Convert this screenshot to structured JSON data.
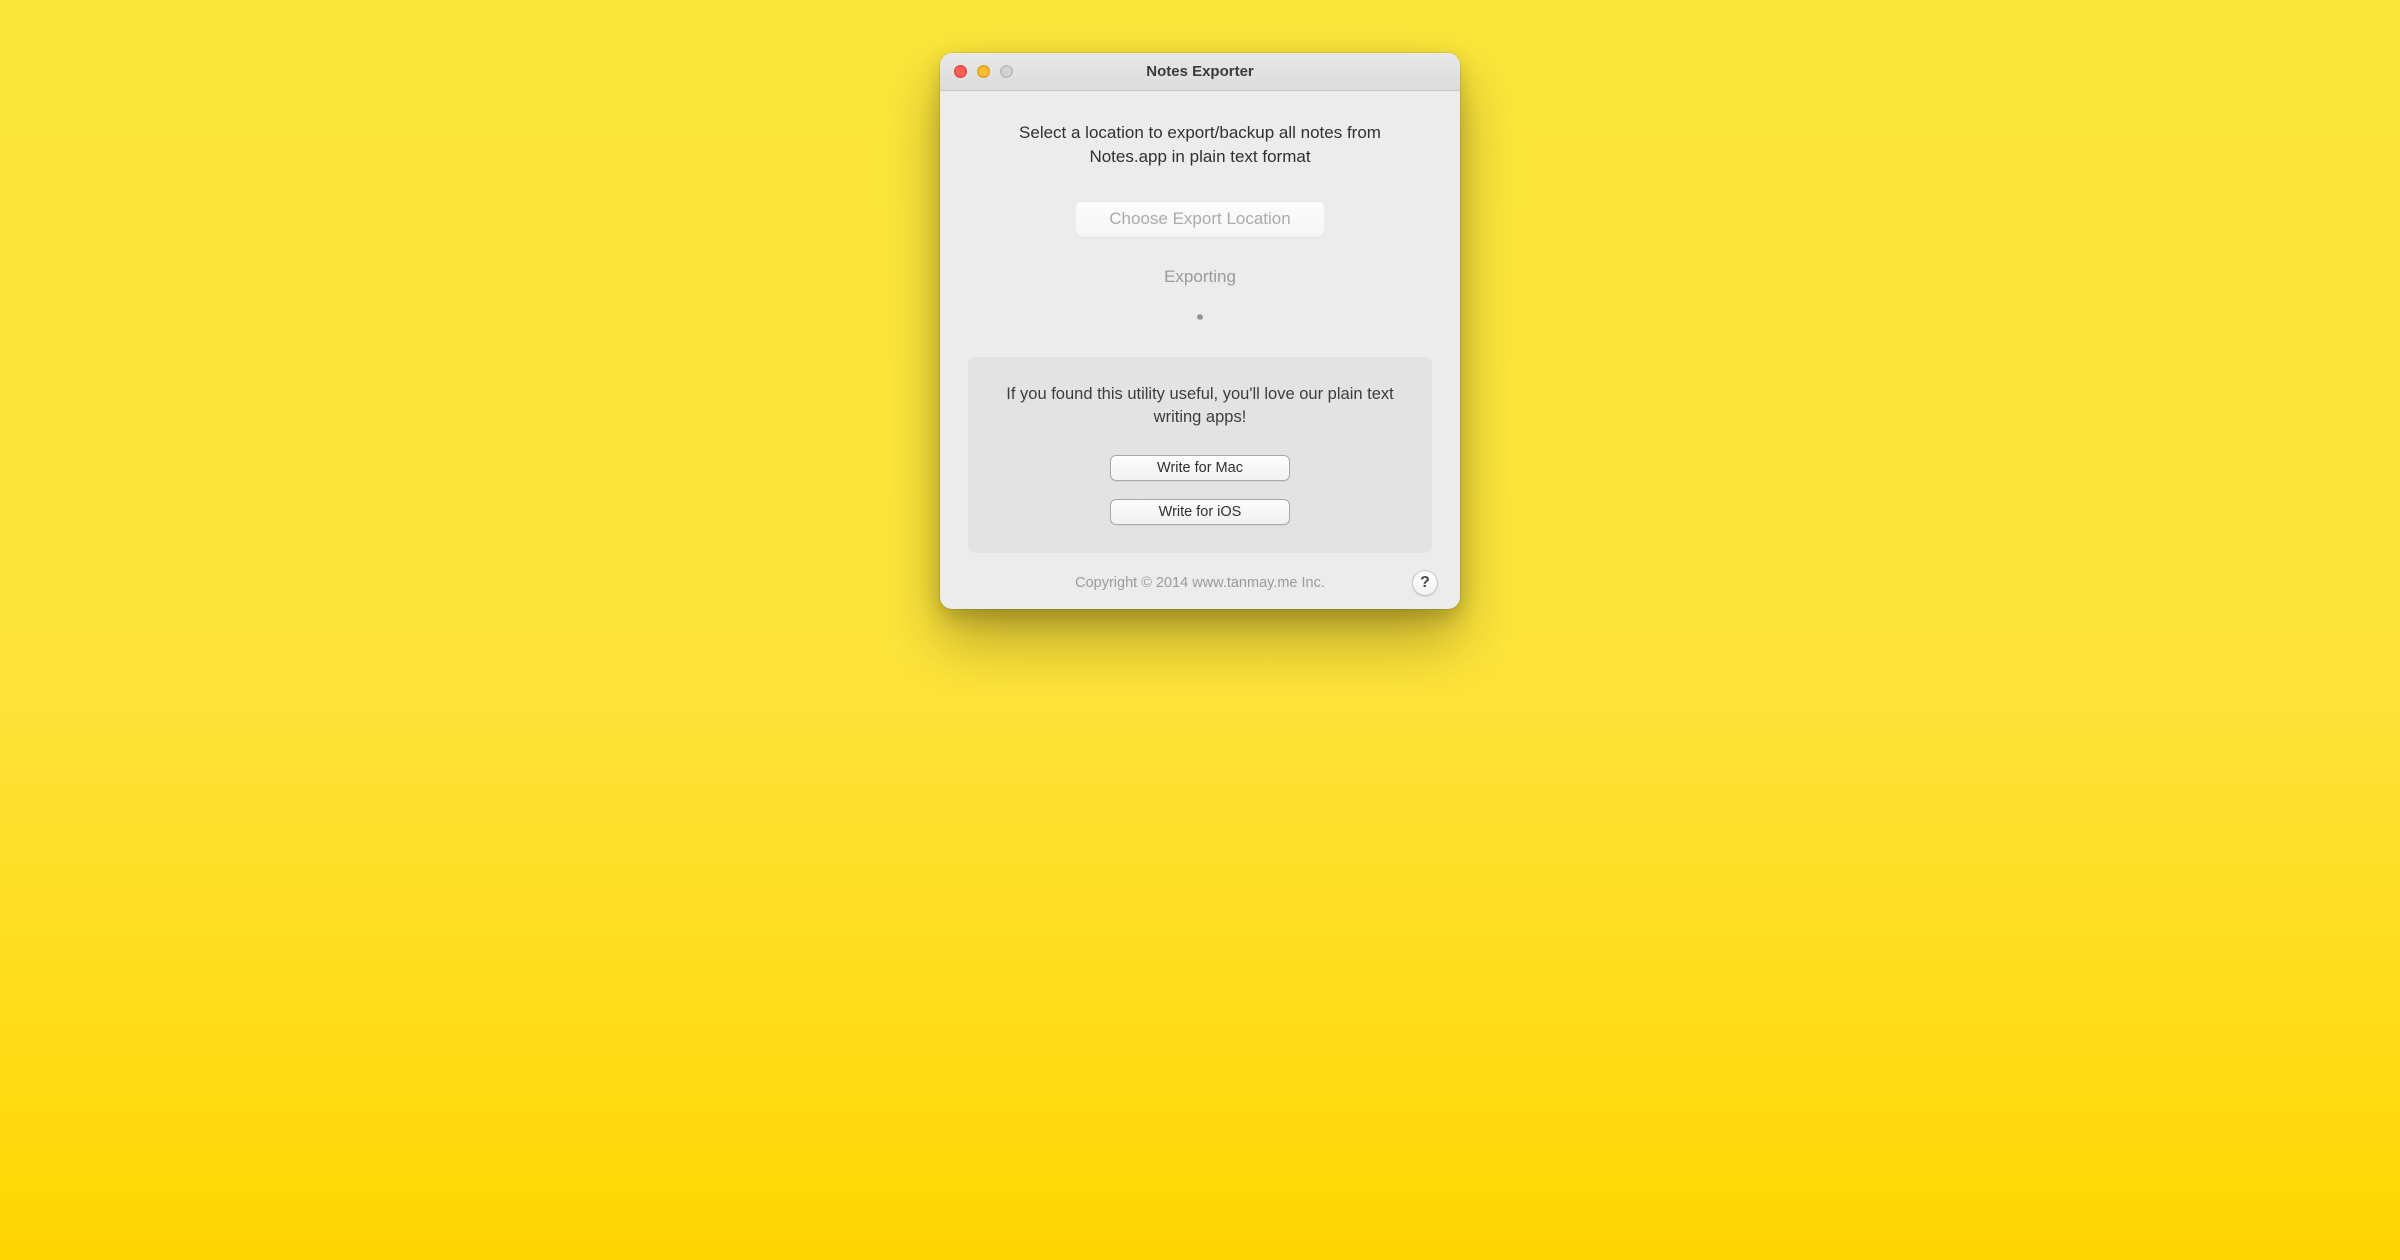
{
  "window": {
    "title": "Notes Exporter"
  },
  "main": {
    "instruction": "Select a location to export/backup all notes from Notes.app in plain text format",
    "choose_button": "Choose Export Location",
    "status": "Exporting"
  },
  "promo": {
    "text": "If you found this utility useful, you'll love our plain text writing apps!",
    "mac_button": "Write for Mac",
    "ios_button": "Write for iOS"
  },
  "footer": {
    "copyright": "Copyright © 2014 www.tanmay.me Inc.",
    "help": "?"
  }
}
